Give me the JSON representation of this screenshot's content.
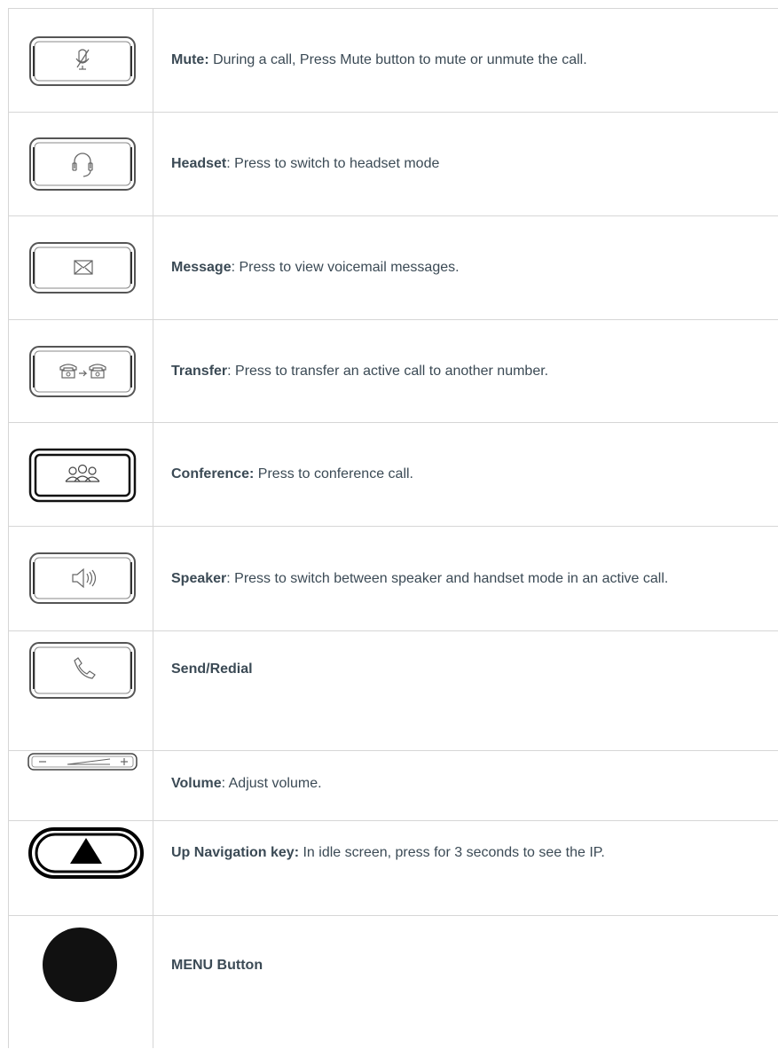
{
  "rows": [
    {
      "name": "Mute",
      "term": "Mute:",
      "desc": " During a call, Press Mute button to mute or unmute the call.",
      "icon": "mute-icon"
    },
    {
      "name": "Headset",
      "term": "Headset",
      "desc": ": Press to switch to headset mode",
      "icon": "headset-icon"
    },
    {
      "name": "Message",
      "term": "Message",
      "desc": ": Press to view voicemail messages.",
      "icon": "envelope-icon"
    },
    {
      "name": "Transfer",
      "term": "Transfer",
      "desc": ": Press to transfer an active call to another number.",
      "icon": "transfer-icon"
    },
    {
      "name": "Conference",
      "term": "Conference:",
      "desc": " Press to conference call.",
      "icon": "conference-icon"
    },
    {
      "name": "Speaker",
      "term": "Speaker",
      "desc": ": Press to switch between speaker and handset mode in an active call.",
      "icon": "speaker-icon"
    },
    {
      "name": "Send/Redial",
      "term": "Send/Redial",
      "desc": "",
      "icon": "phone-handset-icon"
    },
    {
      "name": "Volume",
      "term": "Volume",
      "desc": ": Adjust volume.",
      "icon": "volume-bar-icon"
    },
    {
      "name": "Up Navigation",
      "term": "Up Navigation key:",
      "desc": " In idle screen, press for 3 seconds to see the IP.",
      "icon": "up-arrow-icon"
    },
    {
      "name": "MENU",
      "term": "MENU Button",
      "desc": "",
      "icon": "menu-button-icon"
    }
  ]
}
